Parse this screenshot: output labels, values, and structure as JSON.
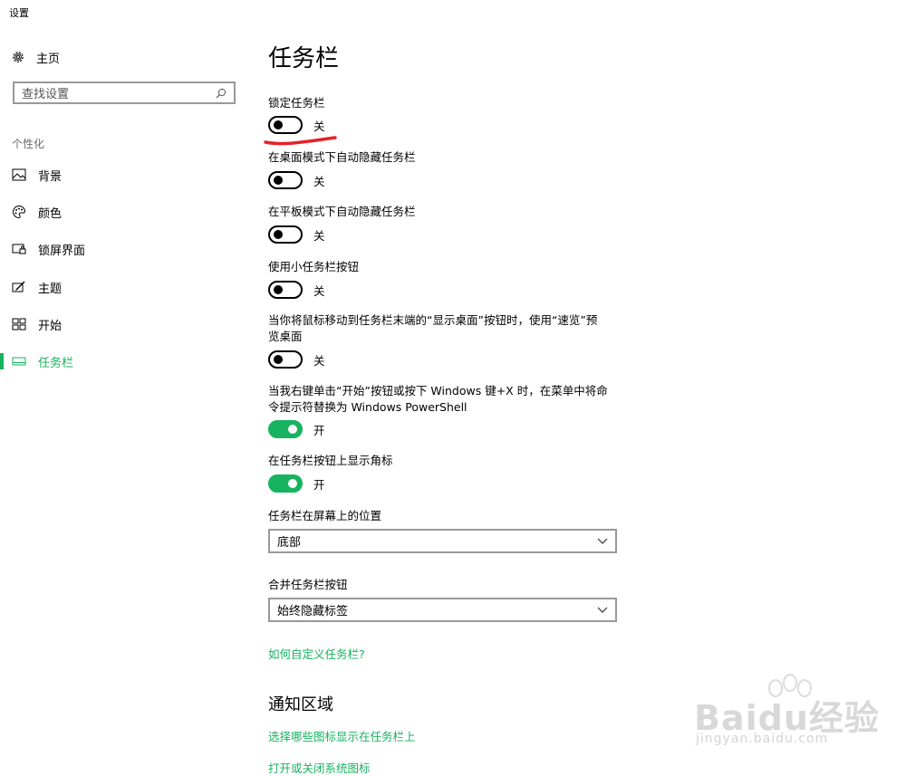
{
  "window": {
    "title": "设置"
  },
  "sidebar": {
    "home_label": "主页",
    "search_placeholder": "查找设置",
    "section": "个性化",
    "items": [
      {
        "label": "背景",
        "icon": "picture-icon"
      },
      {
        "label": "颜色",
        "icon": "palette-icon"
      },
      {
        "label": "锁屏界面",
        "icon": "lock-screen-icon"
      },
      {
        "label": "主题",
        "icon": "theme-icon"
      },
      {
        "label": "开始",
        "icon": "start-grid-icon"
      },
      {
        "label": "任务栏",
        "icon": "taskbar-icon",
        "active": true
      }
    ]
  },
  "main": {
    "title": "任务栏",
    "settings": [
      {
        "label": "锁定任务栏",
        "state": "关",
        "on": false
      },
      {
        "label": "在桌面模式下自动隐藏任务栏",
        "state": "关",
        "on": false
      },
      {
        "label": "在平板模式下自动隐藏任务栏",
        "state": "关",
        "on": false
      },
      {
        "label": "使用小任务栏按钮",
        "state": "关",
        "on": false
      },
      {
        "label_line1": "当你将鼠标移动到任务栏末端的“显示桌面”按钮时，使用“速览”预",
        "label_line2": "览桌面",
        "state": "关",
        "on": false
      },
      {
        "label_line1": "当我右键单击“开始”按钮或按下 Windows 键+X 时，在菜单中将命",
        "label_line2": "令提示符替换为 Windows PowerShell",
        "state": "开",
        "on": true
      },
      {
        "label": "在任务栏按钮上显示角标",
        "state": "开",
        "on": true
      }
    ],
    "position": {
      "label": "任务栏在屏幕上的位置",
      "value": "底部"
    },
    "combine": {
      "label": "合并任务栏按钮",
      "value": "始终隐藏标签"
    },
    "help_link": "如何自定义任务栏?",
    "notification_section": "通知区域",
    "notification_links": [
      "选择哪些图标显示在任务栏上",
      "打开或关闭系统图标"
    ]
  },
  "watermark": {
    "brand": "Baidu经验",
    "url": "jingyan.baidu.com"
  },
  "colors": {
    "accent": "#17b35f",
    "annotation": "#e8202a"
  }
}
